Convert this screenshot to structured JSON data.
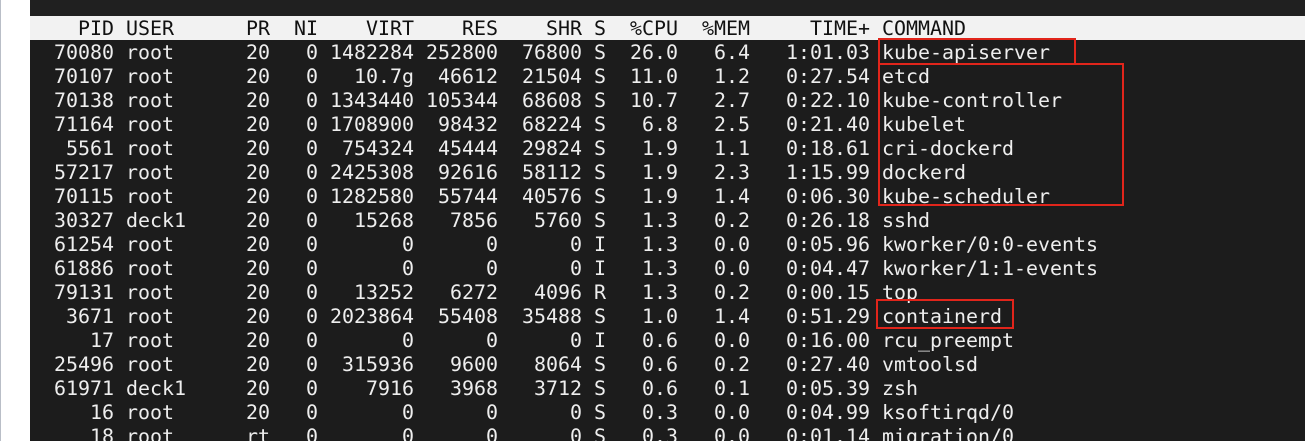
{
  "columns": {
    "pid": "PID",
    "user": "USER",
    "pr": "PR",
    "ni": "NI",
    "virt": "VIRT",
    "res": "RES",
    "shr": "SHR",
    "s": "S",
    "cpu": "%CPU",
    "mem": "%MEM",
    "time": "TIME+",
    "command": "COMMAND"
  },
  "processes": [
    {
      "pid": "70080",
      "user": "root",
      "pr": "20",
      "ni": "0",
      "virt": "1482284",
      "res": "252800",
      "shr": "76800",
      "s": "S",
      "cpu": "26.0",
      "mem": "6.4",
      "time": "1:01.03",
      "command": "kube-apiserver"
    },
    {
      "pid": "70107",
      "user": "root",
      "pr": "20",
      "ni": "0",
      "virt": "10.7g",
      "res": "46612",
      "shr": "21504",
      "s": "S",
      "cpu": "11.0",
      "mem": "1.2",
      "time": "0:27.54",
      "command": "etcd"
    },
    {
      "pid": "70138",
      "user": "root",
      "pr": "20",
      "ni": "0",
      "virt": "1343440",
      "res": "105344",
      "shr": "68608",
      "s": "S",
      "cpu": "10.7",
      "mem": "2.7",
      "time": "0:22.10",
      "command": "kube-controller"
    },
    {
      "pid": "71164",
      "user": "root",
      "pr": "20",
      "ni": "0",
      "virt": "1708900",
      "res": "98432",
      "shr": "68224",
      "s": "S",
      "cpu": "6.8",
      "mem": "2.5",
      "time": "0:21.40",
      "command": "kubelet"
    },
    {
      "pid": "5561",
      "user": "root",
      "pr": "20",
      "ni": "0",
      "virt": "754324",
      "res": "45444",
      "shr": "29824",
      "s": "S",
      "cpu": "1.9",
      "mem": "1.1",
      "time": "0:18.61",
      "command": "cri-dockerd"
    },
    {
      "pid": "57217",
      "user": "root",
      "pr": "20",
      "ni": "0",
      "virt": "2425308",
      "res": "92616",
      "shr": "58112",
      "s": "S",
      "cpu": "1.9",
      "mem": "2.3",
      "time": "1:15.99",
      "command": "dockerd"
    },
    {
      "pid": "70115",
      "user": "root",
      "pr": "20",
      "ni": "0",
      "virt": "1282580",
      "res": "55744",
      "shr": "40576",
      "s": "S",
      "cpu": "1.9",
      "mem": "1.4",
      "time": "0:06.30",
      "command": "kube-scheduler"
    },
    {
      "pid": "30327",
      "user": "deck1",
      "pr": "20",
      "ni": "0",
      "virt": "15268",
      "res": "7856",
      "shr": "5760",
      "s": "S",
      "cpu": "1.3",
      "mem": "0.2",
      "time": "0:26.18",
      "command": "sshd"
    },
    {
      "pid": "61254",
      "user": "root",
      "pr": "20",
      "ni": "0",
      "virt": "0",
      "res": "0",
      "shr": "0",
      "s": "I",
      "cpu": "1.3",
      "mem": "0.0",
      "time": "0:05.96",
      "command": "kworker/0:0-events"
    },
    {
      "pid": "61886",
      "user": "root",
      "pr": "20",
      "ni": "0",
      "virt": "0",
      "res": "0",
      "shr": "0",
      "s": "I",
      "cpu": "1.3",
      "mem": "0.0",
      "time": "0:04.47",
      "command": "kworker/1:1-events"
    },
    {
      "pid": "79131",
      "user": "root",
      "pr": "20",
      "ni": "0",
      "virt": "13252",
      "res": "6272",
      "shr": "4096",
      "s": "R",
      "cpu": "1.3",
      "mem": "0.2",
      "time": "0:00.15",
      "command": "top"
    },
    {
      "pid": "3671",
      "user": "root",
      "pr": "20",
      "ni": "0",
      "virt": "2023864",
      "res": "55408",
      "shr": "35488",
      "s": "S",
      "cpu": "1.0",
      "mem": "1.4",
      "time": "0:51.29",
      "command": "containerd"
    },
    {
      "pid": "17",
      "user": "root",
      "pr": "20",
      "ni": "0",
      "virt": "0",
      "res": "0",
      "shr": "0",
      "s": "I",
      "cpu": "0.6",
      "mem": "0.0",
      "time": "0:16.00",
      "command": "rcu_preempt"
    },
    {
      "pid": "25496",
      "user": "root",
      "pr": "20",
      "ni": "0",
      "virt": "315936",
      "res": "9600",
      "shr": "8064",
      "s": "S",
      "cpu": "0.6",
      "mem": "0.2",
      "time": "0:27.40",
      "command": "vmtoolsd"
    },
    {
      "pid": "61971",
      "user": "deck1",
      "pr": "20",
      "ni": "0",
      "virt": "7916",
      "res": "3968",
      "shr": "3712",
      "s": "S",
      "cpu": "0.6",
      "mem": "0.1",
      "time": "0:05.39",
      "command": "zsh"
    },
    {
      "pid": "16",
      "user": "root",
      "pr": "20",
      "ni": "0",
      "virt": "0",
      "res": "0",
      "shr": "0",
      "s": "S",
      "cpu": "0.3",
      "mem": "0.0",
      "time": "0:04.99",
      "command": "ksoftirqd/0"
    },
    {
      "pid": "18",
      "user": "root",
      "pr": "rt",
      "ni": "0",
      "virt": "0",
      "res": "0",
      "shr": "0",
      "s": "S",
      "cpu": "0.3",
      "mem": "0.0",
      "time": "0:01.14",
      "command": "migration/0"
    }
  ],
  "colors": {
    "terminal_bg": "#1c1c1c",
    "header_bg": "#f2f2f2",
    "text": "#eeeeee",
    "annotation": "#e1251b"
  }
}
